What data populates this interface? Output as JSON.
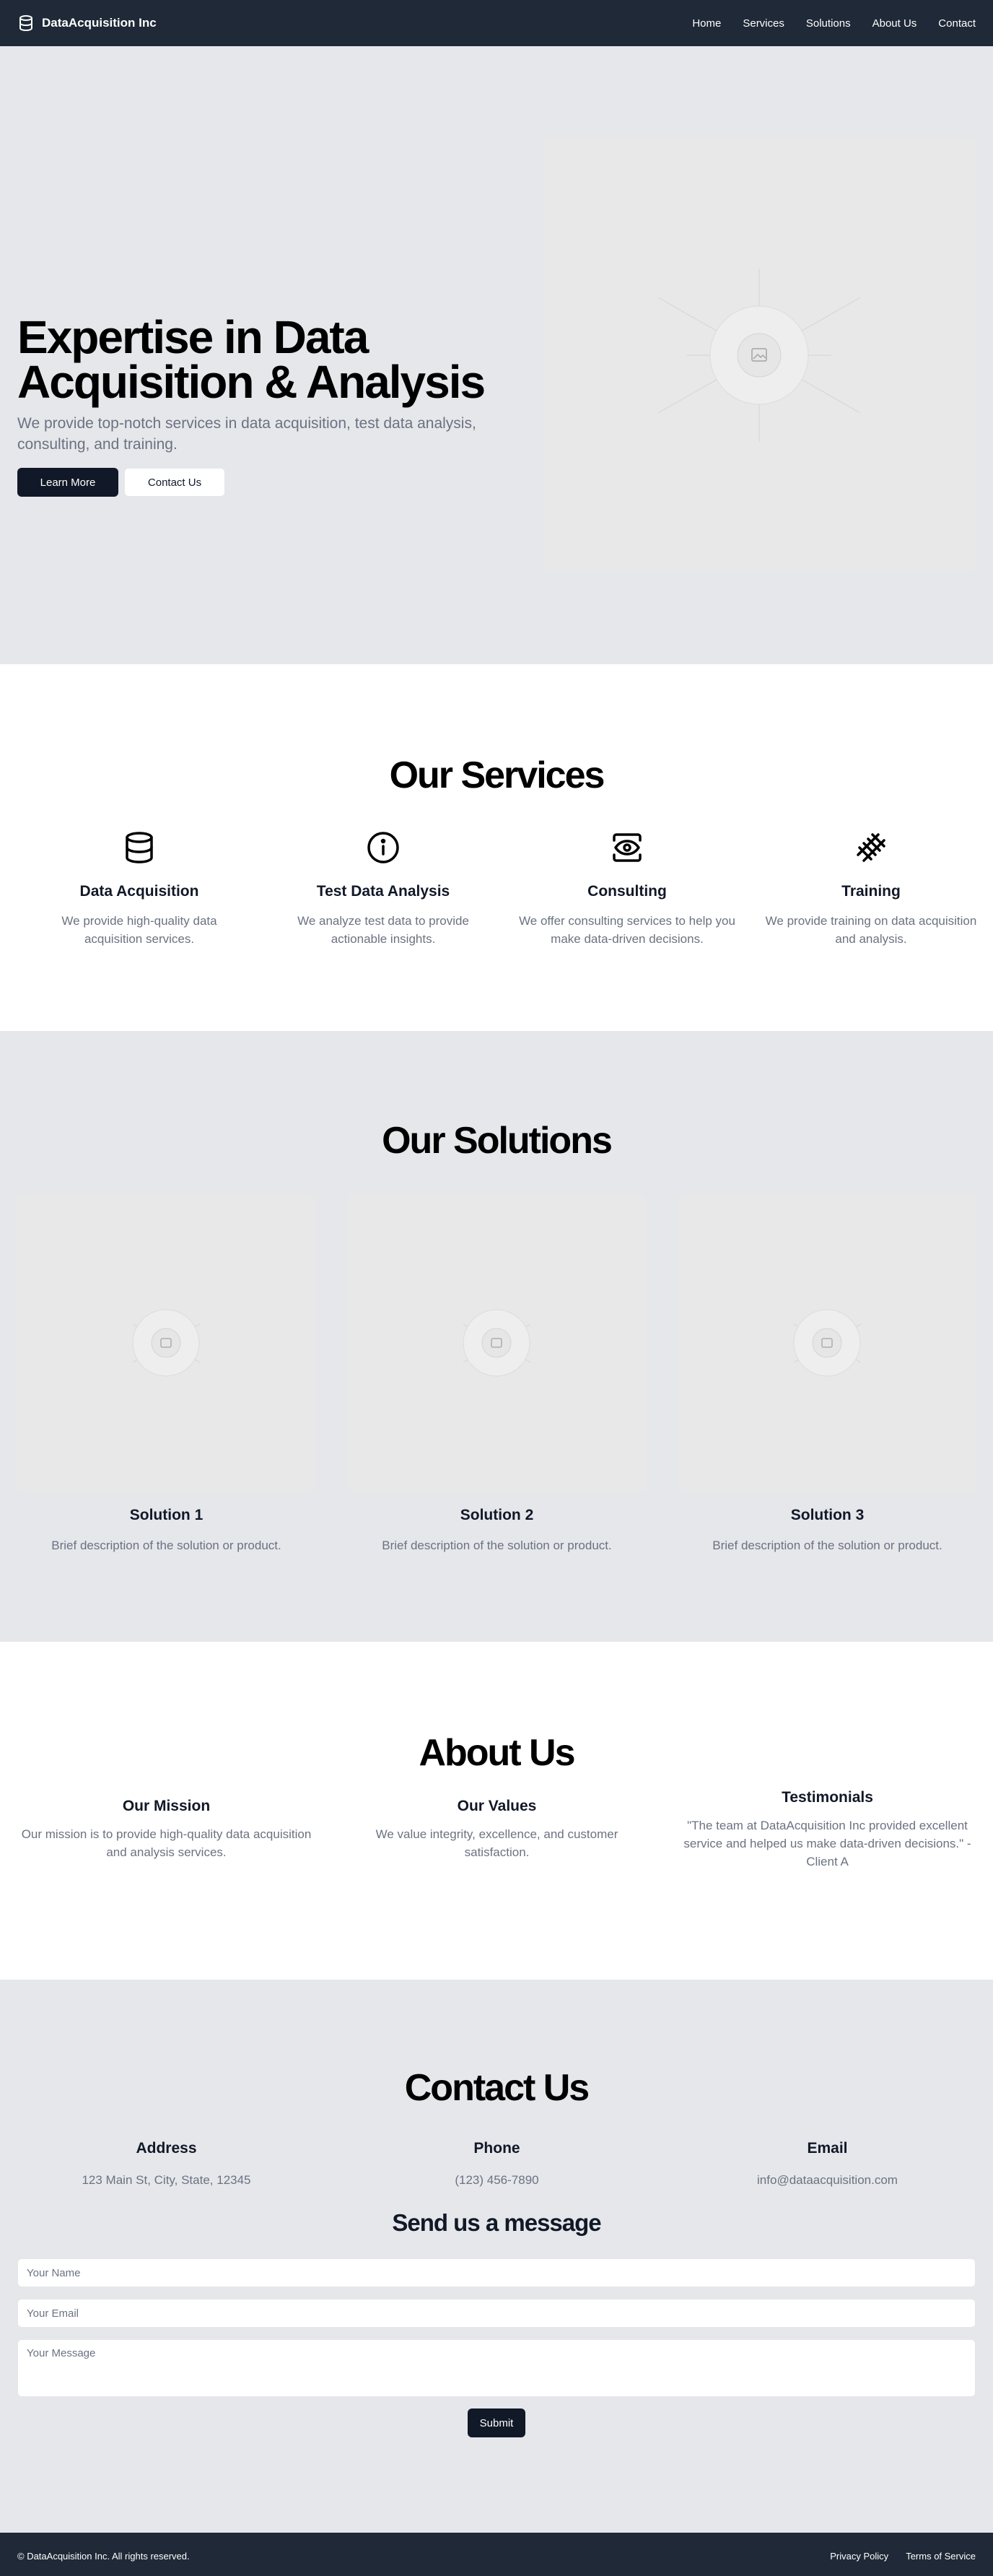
{
  "header": {
    "brand": "DataAcquisition Inc",
    "nav": [
      "Home",
      "Services",
      "Solutions",
      "About Us",
      "Contact"
    ]
  },
  "hero": {
    "title": "Expertise in Data Acquisition & Analysis",
    "subtitle": "We provide top-notch services in data acquisition, test data analysis, consulting, and training.",
    "primary_button": "Learn More",
    "secondary_button": "Contact Us"
  },
  "services": {
    "title": "Our Services",
    "items": [
      {
        "icon": "database-icon",
        "name": "Data Acquisition",
        "desc": "We provide high-quality data acquisition services."
      },
      {
        "icon": "info-icon",
        "name": "Test Data Analysis",
        "desc": "We analyze test data to provide actionable insights."
      },
      {
        "icon": "eye-icon",
        "name": "Consulting",
        "desc": "We offer consulting services to help you make data-driven decisions."
      },
      {
        "icon": "rail-icon",
        "name": "Training",
        "desc": "We provide training on data acquisition and analysis."
      }
    ]
  },
  "solutions": {
    "title": "Our Solutions",
    "items": [
      {
        "name": "Solution 1",
        "desc": "Brief description of the solution or product."
      },
      {
        "name": "Solution 2",
        "desc": "Brief description of the solution or product."
      },
      {
        "name": "Solution 3",
        "desc": "Brief description of the solution or product."
      }
    ]
  },
  "about": {
    "title": "About Us",
    "columns": [
      {
        "heading": "Our Mission",
        "text": "Our mission is to provide high-quality data acquisition and analysis services."
      },
      {
        "heading": "Our Values",
        "text": "We value integrity, excellence, and customer satisfaction."
      },
      {
        "heading": "Testimonials",
        "text": "\"The team at DataAcquisition Inc provided excellent service and helped us make data-driven decisions.\" - Client A"
      }
    ]
  },
  "contact": {
    "title": "Contact Us",
    "columns": [
      {
        "heading": "Address",
        "text": "123 Main St, City, State, 12345"
      },
      {
        "heading": "Phone",
        "text": "(123) 456-7890"
      },
      {
        "heading": "Email",
        "text": "info@dataacquisition.com"
      }
    ],
    "form_title": "Send us a message",
    "name_placeholder": "Your Name",
    "email_placeholder": "Your Email",
    "message_placeholder": "Your Message",
    "submit": "Submit"
  },
  "footer": {
    "copyright": "© DataAcquisition Inc. All rights reserved.",
    "links": [
      "Privacy Policy",
      "Terms of Service"
    ]
  },
  "colors": {
    "header_bg": "#1f2937",
    "section_gray": "#e5e7eb",
    "primary_button": "#111827",
    "muted_text": "#6b7280"
  }
}
